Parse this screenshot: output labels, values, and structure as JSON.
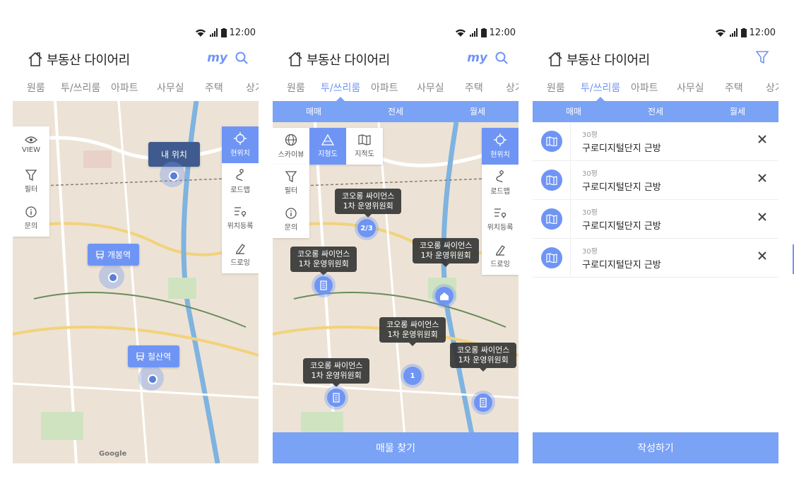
{
  "status": {
    "time": "12:00"
  },
  "app": {
    "title": "부동산 다이어리",
    "my_label": "my"
  },
  "tabs": [
    "원룸",
    "투/쓰리룸",
    "아파트",
    "사무실",
    "주택",
    "상가"
  ],
  "subtabs": [
    "매매",
    "전세",
    "월세"
  ],
  "screen1": {
    "left_controls": [
      {
        "label": "VIEW",
        "icon": "eye-icon"
      },
      {
        "label": "필터",
        "icon": "filter-icon"
      },
      {
        "label": "문의",
        "icon": "info-icon"
      }
    ],
    "right_controls": [
      {
        "label": "현위치",
        "icon": "crosshair-icon"
      },
      {
        "label": "로드맵",
        "icon": "route-icon"
      },
      {
        "label": "위치등록",
        "icon": "pin-list-icon"
      },
      {
        "label": "드로잉",
        "icon": "pencil-icon"
      }
    ],
    "pins": {
      "my_location": "내 위치",
      "station1": "개봉역",
      "station2": "철산역"
    },
    "map_credit": "Google"
  },
  "screen2": {
    "view_modes": [
      {
        "label": "스카이뷰",
        "icon": "globe-icon"
      },
      {
        "label": "지형도",
        "icon": "terrain-icon"
      },
      {
        "label": "지적도",
        "icon": "map-icon"
      }
    ],
    "left_controls": [
      {
        "label": "필터",
        "icon": "filter-icon"
      },
      {
        "label": "문의",
        "icon": "info-icon"
      }
    ],
    "right_controls": [
      {
        "label": "현위치",
        "icon": "crosshair-icon"
      },
      {
        "label": "로드맵",
        "icon": "route-icon"
      },
      {
        "label": "위치등록",
        "icon": "pin-list-icon"
      },
      {
        "label": "드로잉",
        "icon": "pencil-icon"
      }
    ],
    "tooltips": {
      "t1": {
        "line1": "코오롱 싸이언스",
        "line2": "1차 운영위원회"
      },
      "t2": {
        "line1": "코오롱 싸이언스",
        "line2": "1차 운영위원회"
      },
      "t3": {
        "line1": "코오롱 싸이언스",
        "line2": "1차 운영위원회"
      },
      "t4": {
        "line1": "코오롱 싸이언스",
        "line2": "1차 운영위원회"
      },
      "t5": {
        "line1": "코오롱 싸이언스",
        "line2": "1차 운영위원회"
      },
      "t6": {
        "line1": "코오롱 싸이언스",
        "line2": "1차 운영위원회"
      }
    },
    "cluster_labels": {
      "c1": "2/3",
      "c2": "1"
    },
    "bottom_button": "매물 찾기"
  },
  "screen3": {
    "items": [
      {
        "size": "30평",
        "name": "구로디지털단지 근방"
      },
      {
        "size": "30평",
        "name": "구로디지털단지 근방"
      },
      {
        "size": "30평",
        "name": "구로디지털단지 근방"
      },
      {
        "size": "30평",
        "name": "구로디지털단지 근방"
      }
    ],
    "bottom_button": "작성하기"
  },
  "colors": {
    "accent": "#6f95f4",
    "subtab_bg": "#7aa2f5",
    "pin_dark": "#3f5a8e"
  }
}
